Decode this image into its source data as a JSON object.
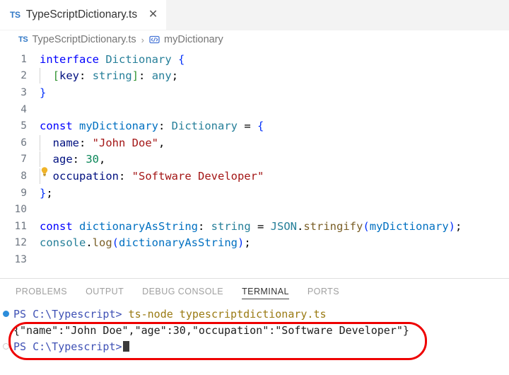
{
  "tab": {
    "icon": "typescript-file-icon",
    "icon_text": "TS",
    "label": "TypeScriptDictionary.ts",
    "close_glyph": "✕"
  },
  "breadcrumb": {
    "icon_text": "TS",
    "file": "TypeScriptDictionary.ts",
    "separator": "›",
    "symbol": "myDictionary"
  },
  "editor": {
    "lightbulb": "quick-fix-lightbulb-icon",
    "lines": [
      {
        "num": "1",
        "indent": false
      },
      {
        "num": "2",
        "indent": true
      },
      {
        "num": "3",
        "indent": false
      },
      {
        "num": "4",
        "indent": false
      },
      {
        "num": "5",
        "indent": false
      },
      {
        "num": "6",
        "indent": true
      },
      {
        "num": "7",
        "indent": true
      },
      {
        "num": "8",
        "indent": true
      },
      {
        "num": "9",
        "indent": false
      },
      {
        "num": "10",
        "indent": false
      },
      {
        "num": "11",
        "indent": false
      },
      {
        "num": "12",
        "indent": false
      },
      {
        "num": "13",
        "indent": false
      }
    ],
    "code": {
      "l1_interface": "interface",
      "l1_name": "Dictionary",
      "l1_brace": "{",
      "l2_open": "[",
      "l2_key": "key",
      "l2_colon": ": ",
      "l2_string": "string",
      "l2_close": "]",
      "l2_colon2": ": ",
      "l2_any": "any",
      "l2_semi": ";",
      "l3_brace": "}",
      "l5_const": "const",
      "l5_var": "myDictionary",
      "l5_colon": ": ",
      "l5_type": "Dictionary",
      "l5_eq": " = ",
      "l5_brace": "{",
      "l6_prop": "name",
      "l6_colon": ": ",
      "l6_val": "\"John Doe\"",
      "l6_comma": ",",
      "l7_prop": "age",
      "l7_colon": ": ",
      "l7_val": "30",
      "l7_comma": ",",
      "l8_prop": "occupation",
      "l8_colon": ": ",
      "l8_val": "\"Software Developer\"",
      "l9_brace": "}",
      "l9_semi": ";",
      "l11_const": "const",
      "l11_var": "dictionaryAsString",
      "l11_colon": ": ",
      "l11_type": "string",
      "l11_eq": " = ",
      "l11_obj": "JSON",
      "l11_dot": ".",
      "l11_fn": "stringify",
      "l11_paren_open": "(",
      "l11_arg": "myDictionary",
      "l11_paren_close": ")",
      "l11_semi": ";",
      "l12_obj": "console",
      "l12_dot": ".",
      "l12_fn": "log",
      "l12_paren_open": "(",
      "l12_arg": "dictionaryAsString",
      "l12_paren_close": ")",
      "l12_semi": ";"
    }
  },
  "panel": {
    "tabs": [
      {
        "label": "PROBLEMS",
        "active": false
      },
      {
        "label": "OUTPUT",
        "active": false
      },
      {
        "label": "DEBUG CONSOLE",
        "active": false
      },
      {
        "label": "TERMINAL",
        "active": true
      },
      {
        "label": "PORTS",
        "active": false
      }
    ]
  },
  "terminal": {
    "prompt": "PS C:\\Typescript>",
    "command": " ts-node typescriptdictionary.ts",
    "output": "{\"name\":\"John Doe\",\"age\":30,\"occupation\":\"Software Developer\"}",
    "prompt2": "PS C:\\Typescript>"
  },
  "annotation": {
    "name": "red-highlight-oval",
    "color": "#ee0000"
  }
}
